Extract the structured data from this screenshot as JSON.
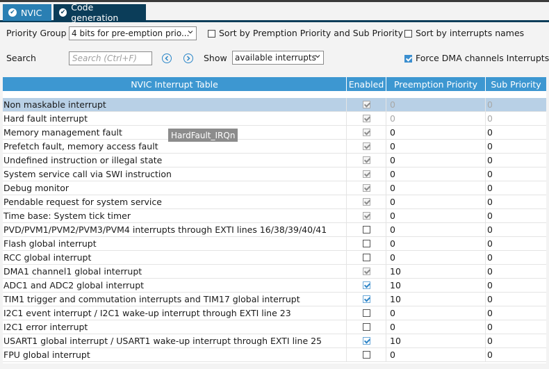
{
  "tabs": [
    {
      "label": "NVIC",
      "icon": "check-circle-icon"
    },
    {
      "label": "Code generation",
      "icon": "check-circle-icon"
    }
  ],
  "controls": {
    "priority_group_label": "Priority Group",
    "priority_group_value": "4 bits for pre-emption prio...",
    "sort_premption_label": "Sort by Premption Priority and Sub Priority",
    "sort_premption_checked": false,
    "sort_names_label": "Sort by interrupts names",
    "sort_names_checked": false,
    "search_label": "Search",
    "search_placeholder": "Search (Ctrl+F)",
    "show_label": "Show",
    "show_value": "available interrupts",
    "force_dma_label": "Force DMA channels Interrupts",
    "force_dma_checked": true
  },
  "table": {
    "headers": [
      "NVIC Interrupt Table",
      "Enabled",
      "Preemption Priority",
      "Sub Priority"
    ],
    "rows": [
      {
        "name": "Non maskable interrupt",
        "enabled": "grey",
        "pre": "0",
        "sub": "0",
        "pre_dis": true,
        "sub_dis": true,
        "selected": true
      },
      {
        "name": "Hard fault interrupt",
        "enabled": "grey",
        "pre": "0",
        "sub": "0",
        "pre_dis": true,
        "sub_dis": true
      },
      {
        "name": "Memory management fault",
        "enabled": "grey",
        "pre": "0",
        "sub": "0"
      },
      {
        "name": "Prefetch fault, memory access fault",
        "enabled": "grey",
        "pre": "0",
        "sub": "0"
      },
      {
        "name": "Undefined instruction or illegal state",
        "enabled": "grey",
        "pre": "0",
        "sub": "0"
      },
      {
        "name": "System service call via SWI instruction",
        "enabled": "grey",
        "pre": "0",
        "sub": "0"
      },
      {
        "name": "Debug monitor",
        "enabled": "grey",
        "pre": "0",
        "sub": "0"
      },
      {
        "name": "Pendable request for system service",
        "enabled": "grey",
        "pre": "0",
        "sub": "0"
      },
      {
        "name": "Time base: System tick timer",
        "enabled": "grey",
        "pre": "0",
        "sub": "0"
      },
      {
        "name": "PVD/PVM1/PVM2/PVM3/PVM4 interrupts through EXTI lines 16/38/39/40/41",
        "enabled": "off",
        "pre": "0",
        "sub": "0"
      },
      {
        "name": "Flash global interrupt",
        "enabled": "off",
        "pre": "0",
        "sub": "0"
      },
      {
        "name": "RCC global interrupt",
        "enabled": "off",
        "pre": "0",
        "sub": "0"
      },
      {
        "name": "DMA1 channel1 global interrupt",
        "enabled": "grey",
        "pre": "10",
        "sub": "0"
      },
      {
        "name": "ADC1 and ADC2 global interrupt",
        "enabled": "on",
        "pre": "10",
        "sub": "0"
      },
      {
        "name": "TIM1 trigger and commutation interrupts and TIM17 global interrupt",
        "enabled": "on",
        "pre": "10",
        "sub": "0"
      },
      {
        "name": "I2C1 event interrupt / I2C1 wake-up interrupt through EXTI line 23",
        "enabled": "off",
        "pre": "0",
        "sub": "0"
      },
      {
        "name": "I2C1 error interrupt",
        "enabled": "off",
        "pre": "0",
        "sub": "0"
      },
      {
        "name": "USART1 global interrupt / USART1 wake-up interrupt through EXTI line 25",
        "enabled": "on",
        "pre": "10",
        "sub": "0"
      },
      {
        "name": "FPU global interrupt",
        "enabled": "off",
        "pre": "0",
        "sub": "0"
      }
    ]
  },
  "tooltip": "HardFault_IRQn"
}
